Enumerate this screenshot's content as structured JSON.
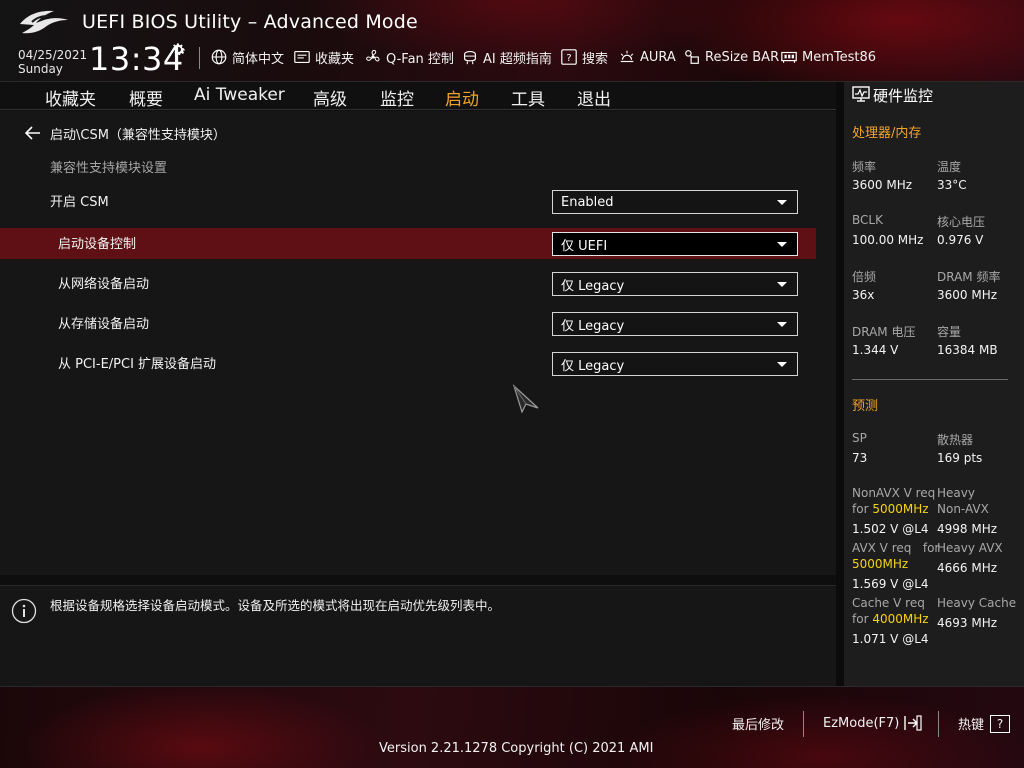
{
  "header": {
    "title": "UEFI BIOS Utility – Advanced Mode",
    "date": "04/25/2021",
    "day": "Sunday",
    "time": "13:34",
    "tools": {
      "language": "简体中文",
      "favorites": "收藏夹",
      "qfan": "Q-Fan 控制",
      "ai_oc": "AI 超频指南",
      "search": "搜索",
      "aura": "AURA",
      "resize_bar": "ReSize BAR",
      "memtest": "MemTest86"
    }
  },
  "tabs": {
    "favorites": "收藏夹",
    "main": "概要",
    "ai_tweaker": "Ai Tweaker",
    "advanced": "高级",
    "monitor": "监控",
    "boot": "启动",
    "tool": "工具",
    "exit": "退出"
  },
  "breadcrumb": "启动\\CSM（兼容性支持模块）",
  "section_heading": "兼容性支持模块设置",
  "settings": {
    "csm": {
      "label": "开启 CSM",
      "value": "Enabled"
    },
    "boot_device_control": {
      "label": "启动设备控制",
      "value": "仅 UEFI"
    },
    "network_boot": {
      "label": "从网络设备启动",
      "value": "仅 Legacy"
    },
    "storage_boot": {
      "label": "从存储设备启动",
      "value": "仅 Legacy"
    },
    "pcie_boot": {
      "label": "从 PCI-E/PCI 扩展设备启动",
      "value": "仅 Legacy"
    }
  },
  "help_text": "根据设备规格选择设备启动模式。设备及所选的模式将出现在启动优先级列表中。",
  "hw_monitor": {
    "title": "硬件监控",
    "cpu_mem_section": "处理器/内存",
    "freq_label": "频率",
    "freq_value": "3600 MHz",
    "temp_label": "温度",
    "temp_value": "33°C",
    "bclk_label": "BCLK",
    "bclk_value": "100.00 MHz",
    "vcore_label": "核心电压",
    "vcore_value": "0.976 V",
    "ratio_label": "倍频",
    "ratio_value": "36x",
    "dram_freq_label": "DRAM 频率",
    "dram_freq_value": "3600 MHz",
    "dram_volt_label": "DRAM 电压",
    "dram_volt_value": "1.344 V",
    "capacity_label": "容量",
    "capacity_value": "16384 MB",
    "prediction_section": "预测",
    "sp_label": "SP",
    "sp_value": "73",
    "cooler_label": "散热器",
    "cooler_value": "169 pts",
    "nonavx_req_a": "NonAVX V req",
    "nonavx_req_for": "for",
    "nonavx_req_freq": "5000MHz",
    "nonavx_req_value": "1.502 V @L4",
    "heavy_nonavx_a": "Heavy",
    "heavy_nonavx_b": "Non-AVX",
    "heavy_nonavx_value": "4998 MHz",
    "avx_req_a": "AVX V req",
    "avx_req_for": "for",
    "avx_req_freq": "5000MHz",
    "avx_req_value": "1.569 V @L4",
    "heavy_avx_label": "Heavy AVX",
    "heavy_avx_value": "4666 MHz",
    "cache_req_a": "Cache V req",
    "cache_req_for": "for",
    "cache_req_freq": "4000MHz",
    "cache_req_value": "1.071 V @L4",
    "heavy_cache_label": "Heavy Cache",
    "heavy_cache_value": "4693 MHz"
  },
  "footer": {
    "last_modified": "最后修改",
    "ezmode": "EzMode(F7)",
    "hotkeys": "热键",
    "hotkeys_key": "?",
    "version": "Version 2.21.1278 Copyright (C) 2021 AMI"
  },
  "colors": {
    "accent": "#f0a32c",
    "highlight_row": "#5e1014",
    "value_highlight": "#f5d312"
  }
}
